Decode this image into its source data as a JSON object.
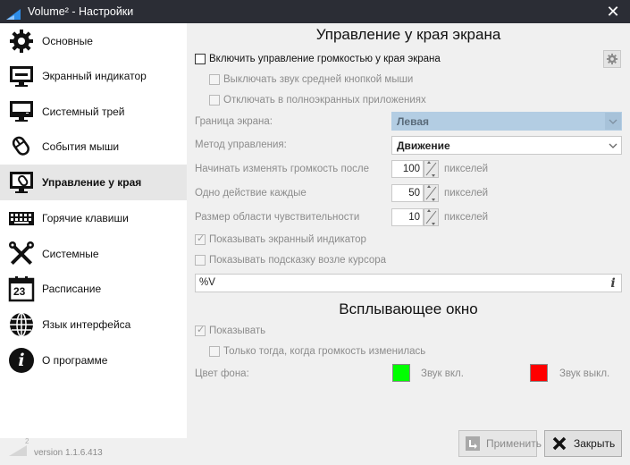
{
  "window": {
    "title": "Volume² - Настройки",
    "close_glyph": "✕"
  },
  "sidebar": {
    "items": [
      {
        "label": "Основные",
        "icon": "gear-icon"
      },
      {
        "label": "Экранный индикатор",
        "icon": "monitor-icon"
      },
      {
        "label": "Системный трей",
        "icon": "tray-icon"
      },
      {
        "label": "События мыши",
        "icon": "mouse-icon"
      },
      {
        "label": "Управление у края",
        "icon": "screen-edge-icon",
        "active": true
      },
      {
        "label": "Горячие клавиши",
        "icon": "keyboard-icon"
      },
      {
        "label": "Системные",
        "icon": "tools-icon"
      },
      {
        "label": "Расписание",
        "icon": "calendar-icon",
        "day": "23"
      },
      {
        "label": "Язык интерфейса",
        "icon": "globe-icon"
      },
      {
        "label": "О программе",
        "icon": "info-icon",
        "glyph": "i"
      }
    ],
    "version": "version 1.1.6.413",
    "logo_sup": "2"
  },
  "edge": {
    "title": "Управление у края экрана",
    "enable_label": "Включить управление громкостью у края экрана",
    "mute_middle_label": "Выключать звук средней кнопкой мыши",
    "fullscreen_label": "Отключать в полноэкранных приложениях",
    "border_label": "Граница экрана:",
    "border_value": "Левая",
    "method_label": "Метод управления:",
    "method_value": "Движение",
    "start_label": "Начинать изменять громкость после",
    "start_value": "100",
    "step_label": "Одно действие каждые",
    "step_value": "50",
    "area_label": "Размер области чувствительности",
    "area_value": "10",
    "unit": "пикселей",
    "show_osd_label": "Показывать экранный индикатор",
    "show_hint_label": "Показывать подсказку возле курсора",
    "hint_format": "%V",
    "info_glyph": "i"
  },
  "popup": {
    "title": "Всплывающее окно",
    "show_label": "Показывать",
    "only_changed_label": "Только тогда, когда громкость изменилась",
    "bg_label": "Цвет фона:",
    "sound_on_label": "Звук вкл.",
    "sound_off_label": "Звук выкл.",
    "sound_on_color": "#00ff00",
    "sound_off_color": "#ff0000"
  },
  "buttons": {
    "apply": "Применить",
    "close": "Закрыть"
  },
  "colors": {
    "titlebar": "#2b2d35",
    "accent_blue": "#1e88e5",
    "combo_disabled": "#b3cde3"
  }
}
